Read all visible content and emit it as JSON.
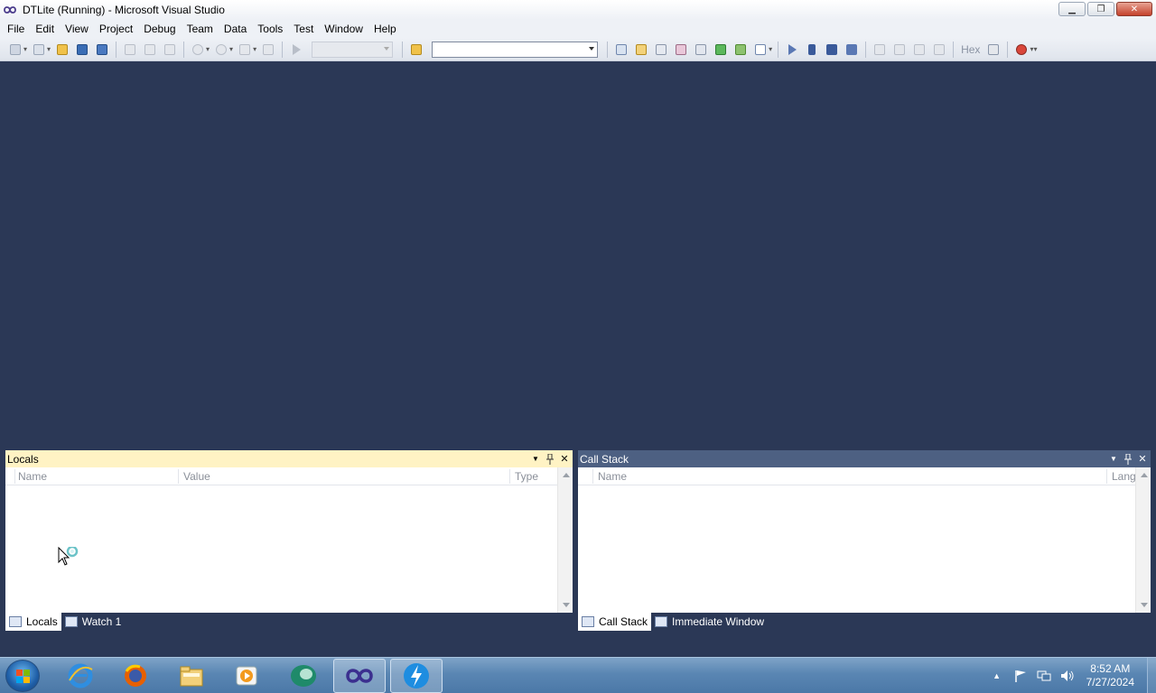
{
  "window": {
    "title": "DTLite (Running) - Microsoft Visual Studio",
    "minimize_glyph": "▁",
    "restore_glyph": "❐",
    "close_glyph": "✕"
  },
  "menu": {
    "items": [
      "File",
      "Edit",
      "View",
      "Project",
      "Debug",
      "Team",
      "Data",
      "Tools",
      "Test",
      "Window",
      "Help"
    ]
  },
  "toolbar": {
    "hex_label": "Hex",
    "find_combo_value": "",
    "config_combo_value": ""
  },
  "locals": {
    "title": "Locals",
    "columns": [
      "Name",
      "Value",
      "Type"
    ],
    "tabs": [
      "Locals",
      "Watch 1"
    ],
    "selected_tab": "Locals"
  },
  "callstack": {
    "title": "Call Stack",
    "columns": [
      "Name",
      "Lang"
    ],
    "tabs": [
      "Call Stack",
      "Immediate Window"
    ],
    "selected_tab": "Call Stack"
  },
  "panel_buttons": {
    "dropdown_glyph": "▼",
    "pin_glyph": "📌",
    "close_glyph": "✕"
  },
  "taskbar": {
    "apps": [
      "internet-explorer-icon",
      "firefox-icon",
      "file-explorer-icon",
      "media-player-icon",
      "app-green-icon",
      "visual-studio-icon",
      "daemon-tools-icon"
    ],
    "time": "8:52 AM",
    "date": "7/27/2024"
  },
  "colors": {
    "ide_background": "#2b3856",
    "active_panel_header": "#fff3c4",
    "inactive_panel_header": "#4d6082"
  }
}
